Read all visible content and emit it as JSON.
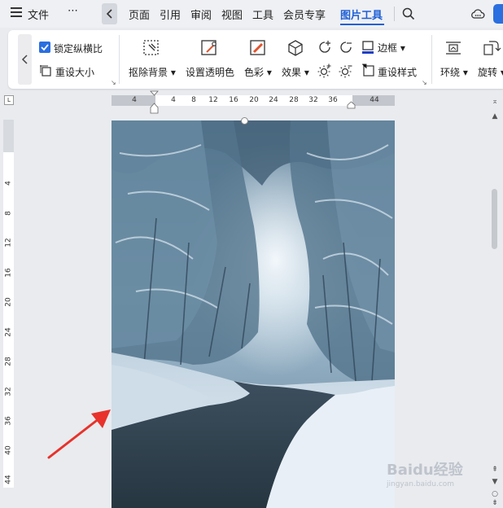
{
  "menu": {
    "file": "文件",
    "more": "⋯",
    "tabs": [
      "页面",
      "引用",
      "审阅",
      "视图",
      "工具",
      "会员专享",
      "图片工具"
    ],
    "active_tab": "图片工具"
  },
  "ribbon": {
    "lock_ratio": "锁定纵横比",
    "reset_size": "重设大小",
    "remove_bg": "抠除背景",
    "set_transparent": "设置透明色",
    "color": "色彩",
    "effects": "效果",
    "border": "边框",
    "reset_style": "重设样式",
    "wrap": "环绕",
    "rotate": "旋转"
  },
  "ruler": {
    "h_ticks": [
      "4",
      "4",
      "8",
      "12",
      "16",
      "20",
      "24",
      "28",
      "32",
      "36",
      "44"
    ],
    "v_ticks": [
      "4",
      "8",
      "12",
      "16",
      "20",
      "24",
      "28",
      "32",
      "36",
      "40",
      "44"
    ]
  },
  "watermark": {
    "brand": "Baidu经验",
    "url": "jingyan.baidu.com"
  },
  "colors": {
    "accent": "#1f5fd6",
    "arrow": "#e8322b"
  }
}
